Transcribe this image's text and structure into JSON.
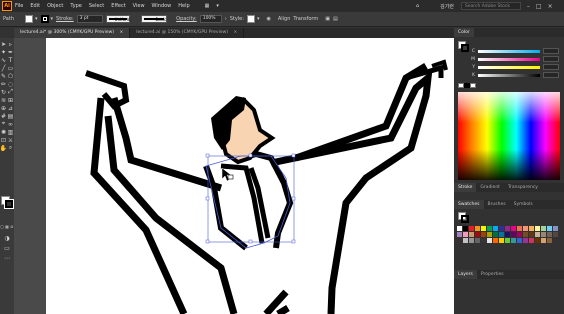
{
  "menubar": {
    "logo": "Ai",
    "items": [
      "File",
      "Edit",
      "Object",
      "Type",
      "Select",
      "Effect",
      "View",
      "Window",
      "Help"
    ],
    "user": "김기런",
    "search_placeholder": "Search Adobe Stock"
  },
  "controlbar": {
    "selection_label": "Path",
    "stroke_label": "Stroke:",
    "stroke_weight": "3 pt",
    "profile_label": "Uniform",
    "brush_label": "Basic",
    "opacity_label": "Opacity:",
    "opacity_value": "100%",
    "style_label": "Style:",
    "align_label": "Align",
    "transform_label": "Transform"
  },
  "tabs": [
    {
      "label": "lecture4.ai* @ 300% (CMYK/GPU Preview)",
      "close": "×",
      "active": true
    },
    {
      "label": "lecture4.ai @ 150% (CMYK/GPU Preview)",
      "close": "×",
      "active": false
    }
  ],
  "right_panel": {
    "color_tabs": [
      "Color"
    ],
    "cmyk_letters": [
      "C",
      "M",
      "Y",
      "K"
    ],
    "stroke_tabs": [
      "Stroke",
      "Gradient",
      "Transparency"
    ],
    "swatch_tabs": [
      "Swatches",
      "Brushes",
      "Symbols"
    ],
    "layer_tabs": [
      "Layers",
      "Properties"
    ]
  },
  "colors": {
    "skin": "#f9d4b3",
    "selection": "#4a5bd6",
    "stroke": "#000000"
  },
  "tools": [
    "selection-tool",
    "direct-selection-tool",
    "magic-wand-tool",
    "pen-tool",
    "curvature-tool",
    "type-tool",
    "line-tool",
    "rectangle-tool",
    "paintbrush-tool",
    "shaper-tool",
    "pencil-tool",
    "eraser-tool",
    "rotate-tool",
    "scale-tool",
    "width-tool",
    "free-transform-tool",
    "shape-builder-tool",
    "perspective-tool",
    "mesh-tool",
    "gradient-tool",
    "eyedropper-tool",
    "blend-tool",
    "symbol-sprayer-tool",
    "graph-tool",
    "artboard-tool",
    "slice-tool",
    "hand-tool",
    "zoom-tool"
  ]
}
